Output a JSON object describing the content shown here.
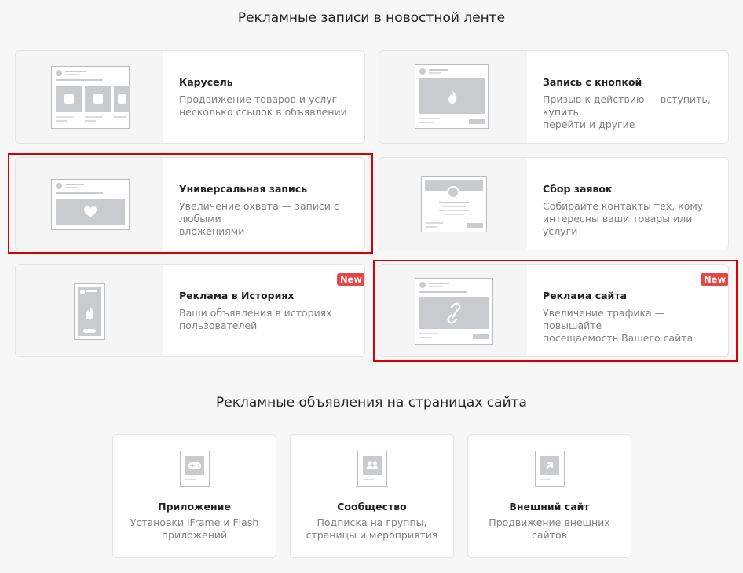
{
  "feed_section": {
    "title": "Рекламные записи в новостной ленте",
    "cards": [
      {
        "title": "Карусель",
        "desc_line1": "Продвижение товаров и услуг —",
        "desc_line2": "несколько ссылок в объявлении"
      },
      {
        "title": "Запись с кнопкой",
        "desc_line1": "Призыв к действию — вступить, купить,",
        "desc_line2": "перейти и другие"
      },
      {
        "title": "Универсальная запись",
        "desc_line1": "Увеличение охвата — записи с любыми",
        "desc_line2": "вложениями"
      },
      {
        "title": "Сбор заявок",
        "desc_line1": "Собирайте контакты тех, кому",
        "desc_line2": "интересны ваши товары или услуги"
      },
      {
        "title": "Реклама в Историях",
        "desc_line1": "Ваши объявления в историях",
        "desc_line2": "пользователей",
        "badge": "New"
      },
      {
        "title": "Реклама сайта",
        "desc_line1": "Увеличение трафика — повышайте",
        "desc_line2": "посещаемость Вашего сайта",
        "badge": "New"
      }
    ]
  },
  "site_section": {
    "title": "Рекламные объявления на страницах сайта",
    "cards": [
      {
        "title": "Приложение",
        "desc_line1": "Установки iFrame и Flash",
        "desc_line2": "приложений",
        "icon": "gamepad-icon"
      },
      {
        "title": "Сообщество",
        "desc_line1": "Подписка на группы,",
        "desc_line2": "страницы и мероприятия",
        "icon": "people-icon"
      },
      {
        "title": "Внешний сайт",
        "desc_line1": "Продвижение внешних",
        "desc_line2": "сайтов",
        "icon": "external-arrow-icon"
      }
    ]
  },
  "colors": {
    "highlight": "#d90000",
    "badge": "#e64646",
    "card_bg": "#ffffff",
    "page_bg": "#f7f7f7"
  }
}
